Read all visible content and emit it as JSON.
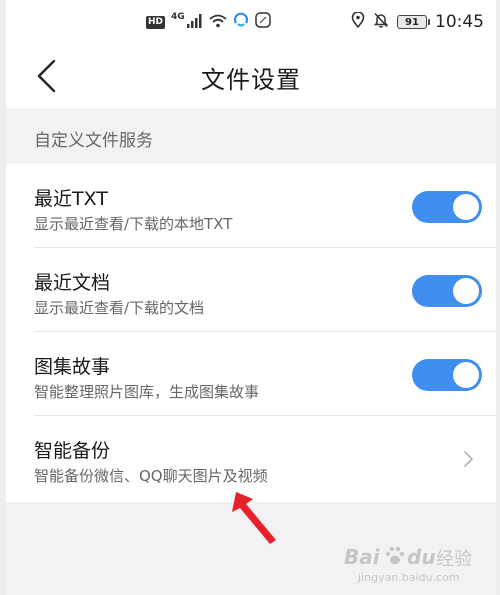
{
  "status_bar": {
    "hd": "HD",
    "network": "4G",
    "battery": "91",
    "time": "10:45"
  },
  "header": {
    "title": "文件设置"
  },
  "section": {
    "title": "自定义文件服务"
  },
  "settings": [
    {
      "title": "最近TXT",
      "subtitle": "显示最近查看/下载的本地TXT",
      "toggle_on": true
    },
    {
      "title": "最近文档",
      "subtitle": "显示最近查看/下载的文档",
      "toggle_on": true
    },
    {
      "title": "图集故事",
      "subtitle": "智能整理照片图库，生成图集故事",
      "toggle_on": true
    },
    {
      "title": "智能备份",
      "subtitle": "智能备份微信、QQ聊天图片及视频"
    }
  ],
  "watermark": {
    "brand": "Bai",
    "brand2": "du",
    "cn": "经验",
    "url": "jingyan.baidu.com"
  },
  "colors": {
    "toggle_on": "#3f8ef0",
    "annotation_arrow": "#e8202a"
  }
}
